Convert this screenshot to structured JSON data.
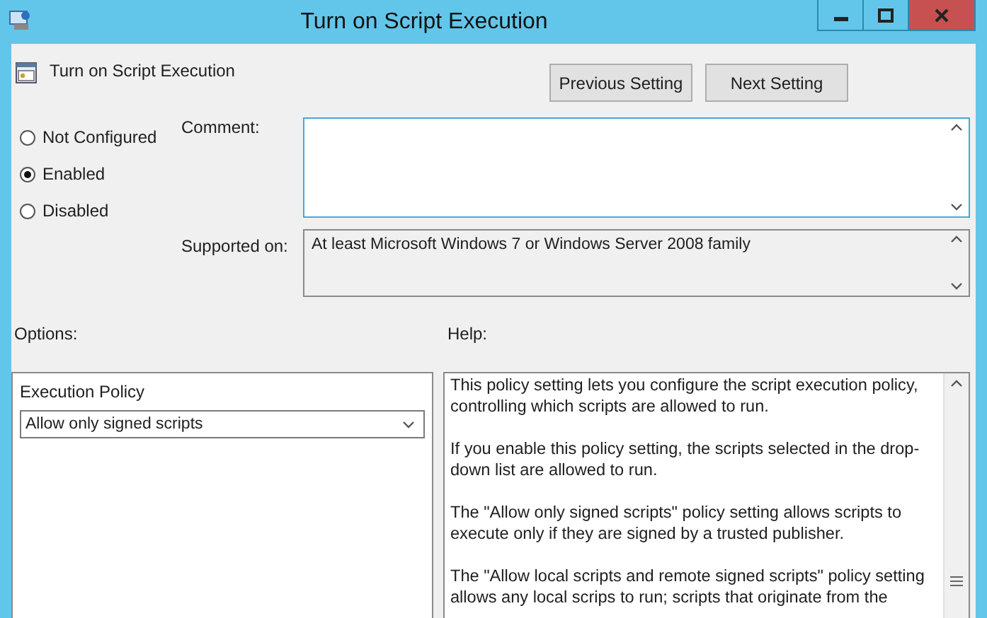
{
  "window": {
    "title": "Turn on Script Execution"
  },
  "header": {
    "setting_name": "Turn on Script Execution"
  },
  "nav_buttons": [
    "Previous Setting",
    "Next Setting"
  ],
  "state_options": [
    {
      "label": "Not Configured",
      "selected": false
    },
    {
      "label": "Enabled",
      "selected": true
    },
    {
      "label": "Disabled",
      "selected": false
    }
  ],
  "comment": {
    "label": "Comment:"
  },
  "supported_on": {
    "label": "Supported on:",
    "value": "At least Microsoft Windows 7 or Windows Server 2008 family"
  },
  "options": {
    "label": "Options:",
    "fields": [
      {
        "kind": "dropdown",
        "label": "Execution Policy",
        "value": "Allow only signed scripts"
      }
    ]
  },
  "help": {
    "label": "Help:",
    "paragraphs": [
      "This policy setting lets you configure the script execution policy, controlling which scripts are allowed to run.",
      "If you enable this policy setting, the scripts selected in the drop-down list are allowed to run.",
      "The \"Allow only signed scripts\" policy setting allows scripts to execute only if they are signed by a trusted publisher.",
      "The \"Allow local scripts and remote signed scripts\" policy setting allows any local scrips to run; scripts that originate from the"
    ]
  }
}
